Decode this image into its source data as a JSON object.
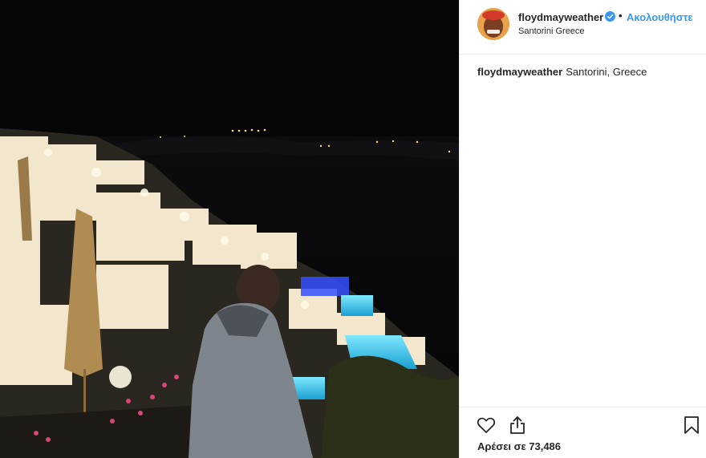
{
  "post": {
    "author": {
      "username": "floydmayweather",
      "verified": true,
      "follow_label": "Ακολουθήστε",
      "location": "Santorini Greece"
    },
    "caption": {
      "username": "floydmayweather",
      "text": "Santorini, Greece"
    },
    "actions": {
      "like_icon": "heart-icon",
      "share_icon": "share-icon",
      "save_icon": "bookmark-icon"
    },
    "likes_text": "Αρέσει σε 73,486"
  },
  "colors": {
    "accent": "#3897f0",
    "text": "#262626",
    "border": "#efefef"
  }
}
